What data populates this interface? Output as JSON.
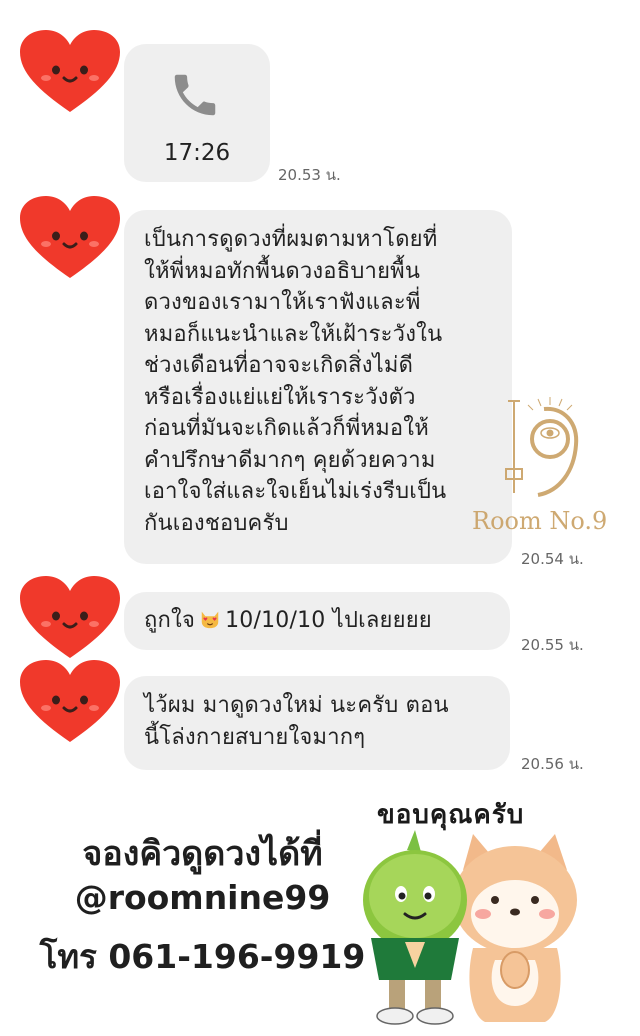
{
  "chat": {
    "messages": [
      {
        "kind": "call",
        "duration": "17:26",
        "time": "20.53 น.",
        "icon": "phone-icon"
      },
      {
        "kind": "text",
        "text": "เป็นการดูดวงที่ผมตามหาโดยที่\nให้พี่หมอทักพื้นดวงอธิบายพื้น\nดวงของเรามาให้เราฟังและพี่\nหมอก็แนะนำและให้เฝ้าระวังใน\nช่วงเดือนที่อาจจะเกิดสิ่งไม่ดี\nหรือเรื่องแย่แย่ให้เราระวังตัว\nก่อนที่มันจะเกิดแล้วก็พี่หมอให้\nคำปรึกษาดีมากๆ คุยด้วยความ\nเอาใจใส่และใจเย็นไม่เร่งรีบเป็น\nกันเองชอบครับ",
        "time": "20.54 น."
      },
      {
        "kind": "text-emoji",
        "text_before": "ถูกใจ",
        "emoji": "heart-eyes-cat-emoji",
        "text_after": "10/10/10 ไปเลยยยย",
        "time": "20.55 น."
      },
      {
        "kind": "text",
        "text": "ไว้ผม มาดูดวงใหม่ นะครับ ตอน\nนี้โล่งกายสบายใจมากๆ",
        "time": "20.56 น."
      }
    ],
    "avatar_icon": "heart-face-icon"
  },
  "watermark": {
    "text": "Room No.9",
    "logo_icon": "room-no9-logo-icon",
    "color": "#c9a063"
  },
  "footer": {
    "line1": "จองคิวดูดวงได้ที่",
    "line2": "@roomnine99",
    "line3": "โทร 061-196-9919"
  },
  "sticker": {
    "caption": "ขอบคุณครับ",
    "icon": "thank-you-sticker-icon"
  },
  "colors": {
    "bubble": "#efefef",
    "heart": "#f0392b",
    "text": "#222222",
    "time": "#666666"
  }
}
